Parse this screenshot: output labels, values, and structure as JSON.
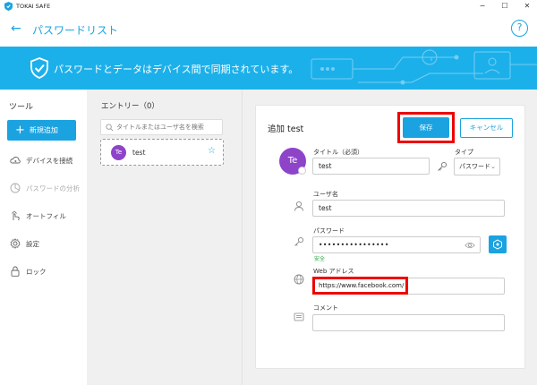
{
  "window": {
    "app_title": "TOKAI SAFE",
    "minimize": "−",
    "maximize": "☐",
    "close": "✕"
  },
  "header": {
    "back": "←",
    "title": "パスワードリスト",
    "help": "?"
  },
  "banner": {
    "text": "パスワードとデータはデバイス間で同期されています。"
  },
  "sidebar": {
    "title": "ツール",
    "new_button": "新規追加",
    "items": [
      {
        "label": "デバイスを接続",
        "icon": "cloud-sync-icon",
        "enabled": true
      },
      {
        "label": "パスワードの分析",
        "icon": "analysis-icon",
        "enabled": false
      },
      {
        "label": "オートフィル",
        "icon": "autofill-icon",
        "enabled": true
      },
      {
        "label": "設定",
        "icon": "gear-icon",
        "enabled": true
      },
      {
        "label": "ロック",
        "icon": "lock-icon",
        "enabled": true
      }
    ]
  },
  "entries": {
    "title": "エントリー（0）",
    "search_placeholder": "タイトルまたはユーザ名を検索",
    "list": [
      {
        "initials": "Te",
        "name": "test",
        "star": "☆"
      }
    ]
  },
  "detail": {
    "title": "追加 test",
    "save": "保存",
    "cancel": "キャンセル",
    "avatar_initials": "Te",
    "title_label": "タイトル（必須）",
    "title_value": "test",
    "type_label": "タイプ",
    "type_value": "パスワード",
    "username_label": "ユーザ名",
    "username_value": "test",
    "password_label": "パスワード",
    "password_value": "••••••••••••••••",
    "strength": "安全",
    "url_label": "Web アドレス",
    "url_value": "https://www.facebook.com/",
    "comment_label": "コメント",
    "comment_value": ""
  },
  "colors": {
    "accent": "#1aa3e0",
    "banner": "#1cb0ea",
    "avatar": "#8e44c9",
    "highlight": "#e00000"
  }
}
